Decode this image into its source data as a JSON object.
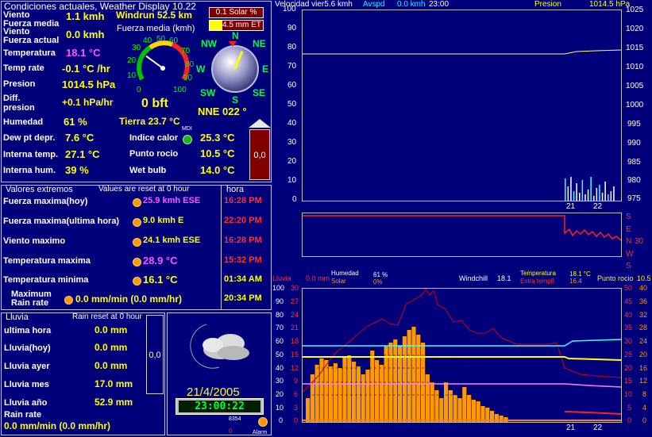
{
  "current": {
    "title": "Condiciones actuales, Weather Display 10.22",
    "rows": [
      {
        "label": "Viento",
        "value": "1.1 kmh"
      },
      {
        "label": "Fuerza media",
        "value": ""
      },
      {
        "label": "Viento",
        "value": "0.0 kmh"
      },
      {
        "label": "Fuerza actual",
        "value": ""
      },
      {
        "label": "Temperatura",
        "value": "18.1 °C"
      },
      {
        "label": "Temp rate",
        "value": "-0.1 °C /hr"
      },
      {
        "label": "Presion",
        "value": "1014.5 hPa"
      },
      {
        "label": "Diff.",
        "value": "+0.1 hPa/hr"
      },
      {
        "label": "presion",
        "value": ""
      },
      {
        "label": "Humedad",
        "value": "61 %"
      },
      {
        "label": "Dew pt depr.",
        "value": "7.6 °C"
      },
      {
        "label": "Interna temp.",
        "value": "27.1 °C"
      },
      {
        "label": "Interna hum.",
        "value": "39 %"
      }
    ],
    "windrun": "Windrun 52.5 km",
    "gauge_title": "Fuerza media (kmh)",
    "gauge_ticks": [
      "0",
      "10",
      "20",
      "30",
      "40",
      "50",
      "60",
      "70",
      "80",
      "90",
      "100"
    ],
    "gauge_value": 30,
    "beaufort": "0 bft",
    "tierra": "Tierra 23.7 °C",
    "compass": {
      "N": "N",
      "NE": "NE",
      "E": "E",
      "SE": "SE",
      "S": "S",
      "SW": "SW",
      "W": "W",
      "NW": "NW"
    },
    "direction": "NNE  022 °",
    "direction_deg": 22,
    "solar": "0.1 Solar %",
    "et": "4.5 mm ET",
    "rain_box": "0,0",
    "indice_label": "Indice calor",
    "indice_value": "25.3 °C",
    "mdi": "MDI",
    "rocio_label": "Punto rocio",
    "rocio_value": "10.5 °C",
    "wetbulb_label": "Wet bulb",
    "wetbulb_value": "14.0 °C"
  },
  "extremes": {
    "title": "Valores extremos",
    "note": "Values are reset at 0 hour",
    "hora": "hora",
    "rows": [
      {
        "label": "Fuerza maxima(hoy)",
        "value": "25.9 kmh ESE",
        "time": "16:28 PM",
        "color": "#ff55ff"
      },
      {
        "label": "Fuerza maxima(ultima hora)",
        "value": "9.0 kmh E",
        "time": "22:20 PM",
        "color": "#ffff00"
      },
      {
        "label": "Viento maximo",
        "value": "24.1 kmh ESE",
        "time": "16:28 PM",
        "color": "#ffff00"
      },
      {
        "label": "Temperatura maxima",
        "value": "28.9 °C",
        "time": "15:32 PM",
        "color": "#ff55ff"
      },
      {
        "label": "Temperatura minima",
        "value": "16.1 °C",
        "time": "01:34 AM",
        "color": "#ffff00"
      },
      {
        "label": "Maximum",
        "label2": "Rain rate",
        "value": "0.0 mm/min (0.0 mm/hr)",
        "time": "20:34 PM",
        "color": "#ffff00"
      }
    ]
  },
  "rain": {
    "title": "Lluvia",
    "note": "Rain reset at 0 hour",
    "rows": [
      {
        "label": "ultima hora",
        "value": "0.0 mm"
      },
      {
        "label": "Lluvia(hoy)",
        "value": "0.0 mm"
      },
      {
        "label": "Lluvia ayer",
        "value": "0.0 mm"
      },
      {
        "label": "Lluvia mes",
        "value": "17.0 mm"
      },
      {
        "label": "Lluvia año",
        "value": "52.9 mm"
      }
    ],
    "rate_label": "Rain rate",
    "rate_value": "0.0 mm/min (0.0 mm/hr)",
    "box": "0,0"
  },
  "forecast": {
    "date": "21/4/2005",
    "time": "23:00:22",
    "counter": "8354",
    "zero": "0",
    "alarm": "Alarm"
  },
  "graph_top": {
    "label_left": "Velocidad vier",
    "vel": "5.6 kmh",
    "avspd": "Avspd",
    "avspd_val": "0.0 kmh",
    "time": "23:00",
    "presion_label": "Presion",
    "presion_val": "1014.5 hPa",
    "left_ticks": [
      "100",
      "90",
      "80",
      "70",
      "60",
      "50",
      "40",
      "30",
      "20",
      "10",
      "0"
    ],
    "right_ticks": [
      "1025",
      "1020",
      "1015",
      "1010",
      "1005",
      "1000",
      "995",
      "990",
      "985",
      "980",
      "975"
    ],
    "x_ticks": [
      "21",
      "22"
    ]
  },
  "graph_dir": {
    "labels": [
      "S",
      "E",
      "N",
      "W",
      "S"
    ],
    "n_val": "30"
  },
  "graph_bottom": {
    "lluvia": "Lluvia",
    "lluvia_val": "0.0 mm",
    "humedad": "Humedad",
    "humedad_val": "61 %",
    "solar": "Solar",
    "solar_val": "0%",
    "windchill": "Windchill",
    "windchill_val": "18.1",
    "temperatura": "Temperatura",
    "temperatura_val": "18.1 °C",
    "extra": "Extra temp8",
    "extra_val": "16.4",
    "rocio": "Punto rocio",
    "rocio_val": "10.5",
    "ticks_hum": [
      "100",
      "90",
      "80",
      "70",
      "60",
      "50",
      "40",
      "30",
      "20",
      "10",
      "0"
    ],
    "ticks_rain": [
      "30",
      "27",
      "24",
      "21",
      "18",
      "15",
      "12",
      "9",
      "6",
      "3",
      "0"
    ],
    "ticks_right": [
      "50",
      "45",
      "40",
      "35",
      "30",
      "25",
      "20",
      "15",
      "10",
      "5",
      "0"
    ],
    "ticks_far": [
      "40",
      "36",
      "32",
      "28",
      "24",
      "20",
      "16",
      "12",
      "8",
      "4",
      "0"
    ],
    "x_ticks": [
      "21",
      "22"
    ]
  }
}
